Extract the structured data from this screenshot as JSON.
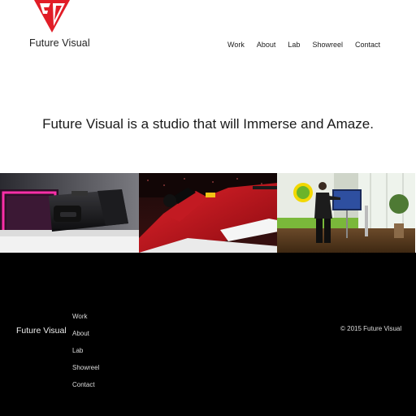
{
  "header": {
    "brand": "Future Visual",
    "logo_color": "#e11d27",
    "nav": [
      "Work",
      "About",
      "Lab",
      "Showreel",
      "Contact"
    ]
  },
  "hero": {
    "tagline": "Future Visual is a studio that will Immerse and Amaze."
  },
  "gallery": [
    {
      "subject": "vr-headset-image"
    },
    {
      "subject": "race-car-image"
    },
    {
      "subject": "person-at-screen-image"
    }
  ],
  "footer": {
    "brand": "Future Visual",
    "nav": [
      "Work",
      "About",
      "Lab",
      "Showreel",
      "Contact"
    ],
    "copyright": "© 2015 Future Visual",
    "background": "#000000"
  }
}
